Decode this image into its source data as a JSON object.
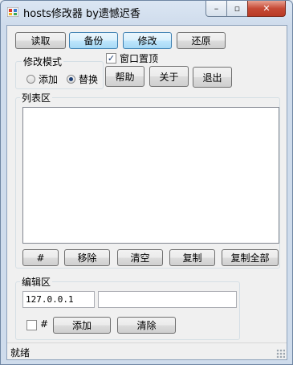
{
  "window": {
    "title": "hosts修改器 by遗憾迟香",
    "min_glyph": "–",
    "max_glyph": "▫",
    "close_glyph": "✕"
  },
  "toolbar": {
    "read": "读取",
    "backup": "备份",
    "modify": "修改",
    "restore": "还原"
  },
  "mode_group": {
    "label": "修改模式",
    "add": "添加",
    "replace": "替换",
    "selected": "replace"
  },
  "topmost": {
    "label": "窗口置顶",
    "checked": true
  },
  "actions": {
    "help": "帮助",
    "about": "关于",
    "exit": "退出"
  },
  "list_group": {
    "label": "列表区",
    "items": []
  },
  "list_buttons": {
    "hash": "#",
    "remove": "移除",
    "clear": "清空",
    "copy": "复制",
    "copy_all": "复制全部"
  },
  "edit_group": {
    "label": "编辑区",
    "ip_value": "127.0.0.1",
    "host_value": "",
    "hash_label": "#",
    "hash_checked": false,
    "add": "添加",
    "clear": "清除"
  },
  "status": {
    "text": "就绪"
  }
}
